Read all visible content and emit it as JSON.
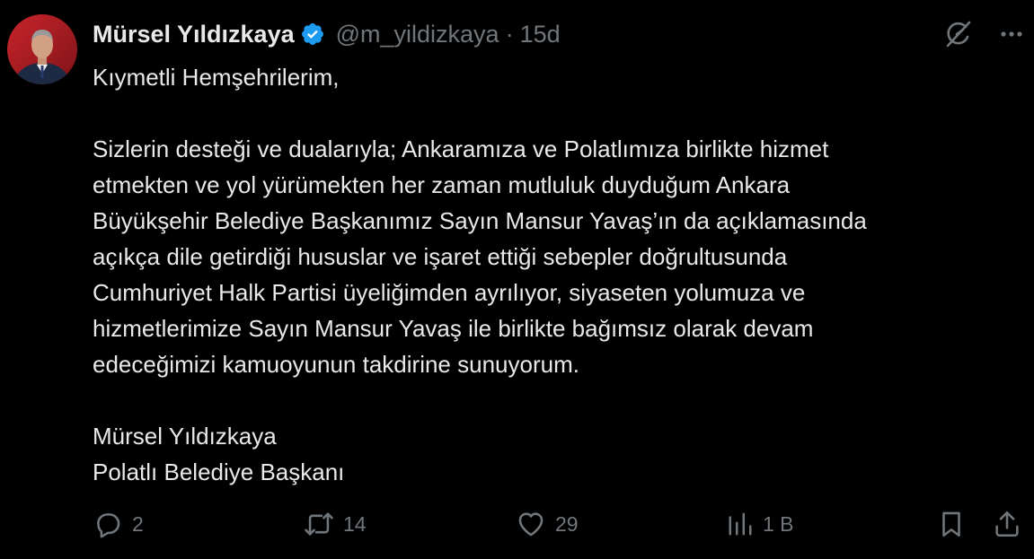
{
  "author": {
    "display_name": "Mürsel Yıldızkaya",
    "handle": "@m_yildizkaya",
    "separator": "·",
    "time": "15d",
    "verified": true
  },
  "tweet": {
    "lines": [
      "Kıymetli Hemşehrilerim,",
      "",
      "Sizlerin desteği ve dualarıyla; Ankaramıza ve Polatlımıza birlikte hizmet",
      "etmekten ve yol yürümekten her zaman mutluluk duyduğum Ankara",
      "Büyükşehir Belediye Başkanımız Sayın Mansur Yavaş’ın da açıklamasında",
      "açıkça dile getirdiği hususlar ve işaret ettiği sebepler doğrultusunda",
      "Cumhuriyet Halk Partisi üyeliğimden ayrılıyor, siyaseten yolumuza ve",
      "hizmetlerimize Sayın Mansur Yavaş ile birlikte bağımsız olarak devam",
      "edeceğimizi kamuoyunun takdirine sunuyorum.",
      "",
      "Mürsel Yıldızkaya",
      "Polatlı Belediye Başkanı"
    ]
  },
  "actions": {
    "replies": "2",
    "reposts": "14",
    "likes": "29",
    "views": "1 B"
  },
  "icons": {
    "verified": "verified-badge-icon",
    "grok": "grok-icon",
    "more": "more-icon",
    "reply": "reply-icon",
    "repost": "repost-icon",
    "like": "like-icon",
    "views": "views-icon",
    "bookmark": "bookmark-icon",
    "share": "share-icon"
  },
  "colors": {
    "background": "#000000",
    "text": "#e7e9ea",
    "muted": "#71767b",
    "verified": "#1d9bf0"
  }
}
